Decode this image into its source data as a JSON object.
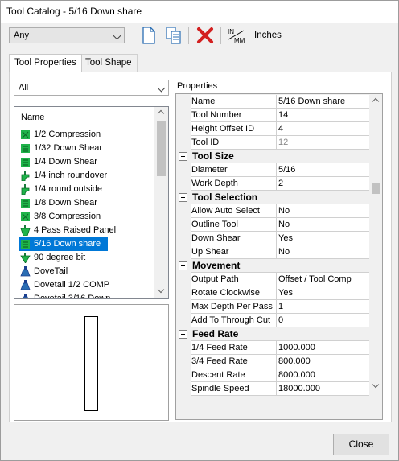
{
  "window": {
    "title": "Tool Catalog - 5/16 Down share"
  },
  "toolbar": {
    "filter_value": "Any",
    "units_label": "Inches",
    "units_toggle_text": "IN/MM",
    "units_top": "IN",
    "units_bottom": "MM"
  },
  "tabs": [
    {
      "label": "Tool Properties",
      "active": true
    },
    {
      "label": "Tool Shape",
      "active": false
    }
  ],
  "left": {
    "category_filter": "All",
    "list_header": "Name",
    "items": [
      {
        "label": "1/2 Compression",
        "icon": "green-compression-bit-icon",
        "selected": false
      },
      {
        "label": "1/32 Down Shear",
        "icon": "green-shear-bit-icon",
        "selected": false
      },
      {
        "label": "1/4 Down Shear",
        "icon": "green-shear-bit-icon",
        "selected": false
      },
      {
        "label": "1/4 inch roundover",
        "icon": "roundover-bit-icon",
        "selected": false
      },
      {
        "label": "1/4 round outside",
        "icon": "roundover-bit-icon",
        "selected": false
      },
      {
        "label": "1/8 Down Shear",
        "icon": "green-shear-bit-icon",
        "selected": false
      },
      {
        "label": "3/8 Compression",
        "icon": "green-compression-bit-icon",
        "selected": false
      },
      {
        "label": "4 Pass Raised Panel",
        "icon": "raised-panel-bit-icon",
        "selected": false
      },
      {
        "label": "5/16 Down share",
        "icon": "green-shear-bit-icon",
        "selected": true
      },
      {
        "label": "90 degree bit",
        "icon": "v-bit-icon",
        "selected": false
      },
      {
        "label": "DoveTail",
        "icon": "dovetail-bit-icon",
        "selected": false
      },
      {
        "label": "Dovetail 1/2 COMP",
        "icon": "dovetail-bit-icon",
        "selected": false
      },
      {
        "label": "Dovetail 3/16 Down",
        "icon": "dovetail-bit-icon",
        "selected": false
      }
    ]
  },
  "properties": {
    "header": "Properties",
    "rows": [
      {
        "type": "prop",
        "key": "Name",
        "value": "5/16 Down share"
      },
      {
        "type": "prop",
        "key": "Tool Number",
        "value": "14"
      },
      {
        "type": "prop",
        "key": "Height Offset ID",
        "value": "4"
      },
      {
        "type": "prop",
        "key": "Tool ID",
        "value": "12",
        "disabled": true
      },
      {
        "type": "cat",
        "label": "Tool Size"
      },
      {
        "type": "prop",
        "key": "Diameter",
        "value": "5/16"
      },
      {
        "type": "prop",
        "key": "Work Depth",
        "value": "2"
      },
      {
        "type": "cat",
        "label": "Tool Selection"
      },
      {
        "type": "prop",
        "key": "Allow Auto Select",
        "value": "No"
      },
      {
        "type": "prop",
        "key": "Outline Tool",
        "value": "No"
      },
      {
        "type": "prop",
        "key": "Down Shear",
        "value": "Yes"
      },
      {
        "type": "prop",
        "key": "Up Shear",
        "value": "No"
      },
      {
        "type": "cat",
        "label": "Movement"
      },
      {
        "type": "prop",
        "key": "Output Path",
        "value": "Offset / Tool Comp"
      },
      {
        "type": "prop",
        "key": "Rotate Clockwise",
        "value": "Yes"
      },
      {
        "type": "prop",
        "key": "Max Depth Per Pass",
        "value": "1"
      },
      {
        "type": "prop",
        "key": "Add To Through Cut",
        "value": "0"
      },
      {
        "type": "cat",
        "label": "Feed Rate"
      },
      {
        "type": "prop",
        "key": "1/4 Feed Rate",
        "value": "1000.000"
      },
      {
        "type": "prop",
        "key": "3/4 Feed Rate",
        "value": "800.000"
      },
      {
        "type": "prop",
        "key": "Descent Rate",
        "value": "8000.000"
      },
      {
        "type": "prop",
        "key": "Spindle Speed",
        "value": "18000.000"
      }
    ]
  },
  "footer": {
    "close_label": "Close"
  },
  "colors": {
    "selection": "#0078d7",
    "delete_red": "#d32020",
    "bit_green": "#1fb34a"
  }
}
